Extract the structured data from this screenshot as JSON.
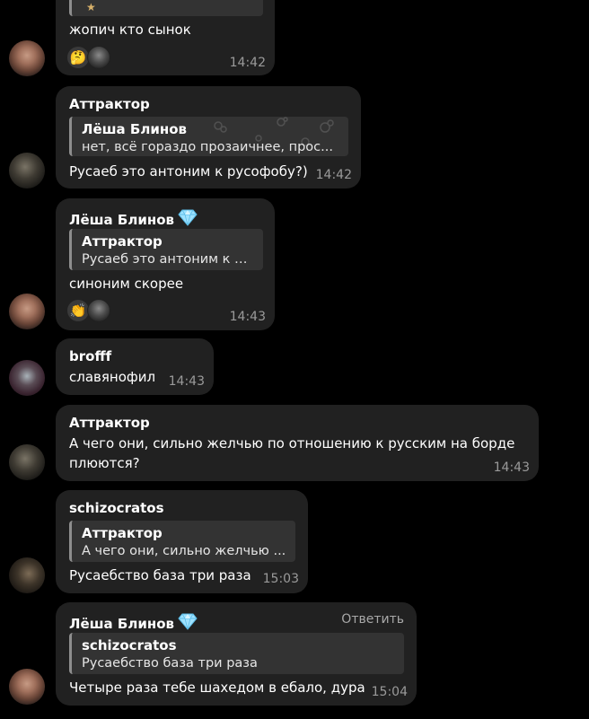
{
  "messages": [
    {
      "sender": "",
      "text": "жопич кто сынок",
      "time": "14:42",
      "reactions": {
        "emoji": "🤔",
        "icon": "thinking-face-icon"
      }
    },
    {
      "sender": "Аттрактор",
      "quote": {
        "name": "Лёша Блинов",
        "text": "нет, всё гораздо прозаичнее, прос..."
      },
      "text": "Русаеб это антоним к русофобу?)",
      "time": "14:42"
    },
    {
      "sender": "Лёша Блинов",
      "sender_badge": "gem-icon",
      "quote": {
        "name": "Аттрактор",
        "text": "Русаеб это антоним к р..."
      },
      "text": "синоним скорее",
      "time": "14:43",
      "reactions": {
        "emoji": "👏",
        "icon": "clapping-hands-icon"
      }
    },
    {
      "sender": "brofff",
      "text": "славянофил",
      "time": "14:43"
    },
    {
      "sender": "Аттрактор",
      "text_lines": [
        "А чего они, сильно желчью по отношению к русским на борде",
        "плюются?"
      ],
      "time": "14:43"
    },
    {
      "sender": "schizocratos",
      "quote": {
        "name": "Аттрактор",
        "text": "А чего они, сильно желчью ..."
      },
      "text": "Русаебство база три раза",
      "time": "15:03"
    },
    {
      "sender": "Лёша Блинов",
      "sender_badge": "gem-icon",
      "reply_action": "Ответить",
      "quote": {
        "name": "schizocratos",
        "text": "Русаебство база три раза"
      },
      "text": "Четыре раза тебе шахедом в ебало, дура",
      "time": "15:04"
    }
  ],
  "colors": {
    "background": "#000000",
    "bubble": "#212121",
    "quote_bg": "#333333",
    "quote_bar": "#8e8e8e",
    "time": "#9a9a9a",
    "gem": "#7fd3ff"
  }
}
